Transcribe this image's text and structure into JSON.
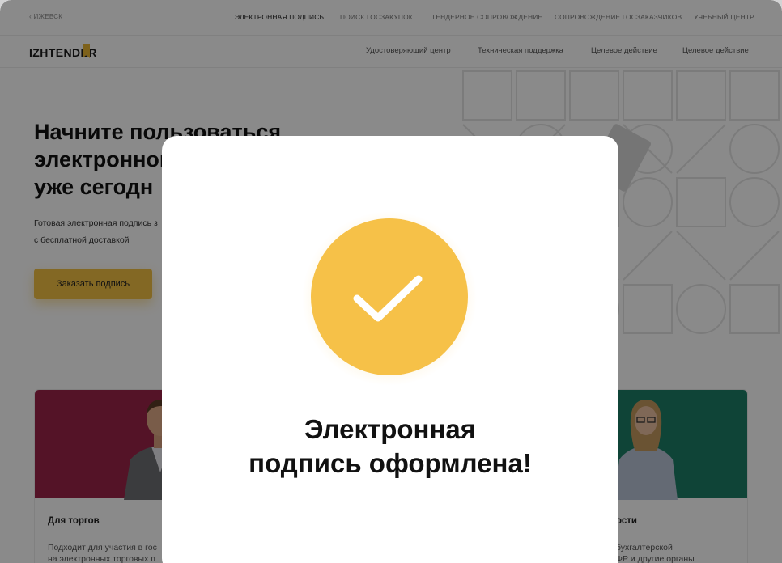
{
  "topbar": {
    "city": "‹ ИЖЕВСК",
    "nav": [
      "ЭЛЕКТРОННАЯ ПОДПИСЬ",
      "ПОИСК ГОСЗАКУПОК",
      "ТЕНДЕРНОЕ СОПРОВОЖДЕНИЕ",
      "СОПРОВОЖДЕНИЕ ГОСЗАКАЗЧИКОВ",
      "УЧЕБНЫЙ ЦЕНТР"
    ]
  },
  "navbar": {
    "logo": "IZHTENDER",
    "items": [
      "Удостоверяющий центр",
      "Техническая поддержка",
      "Целевое действие",
      "Целевое действие"
    ]
  },
  "hero": {
    "title_lines": [
      "Начните пользоваться",
      "электронной",
      "уже сегодн"
    ],
    "subtitle_lines": [
      "Готовая электронная подпись з",
      "с бесплатной доставкой"
    ],
    "order_button": "Заказать подпись"
  },
  "cards": [
    {
      "title": "Для торгов",
      "text_lines": [
        "Подходит для участия в гос",
        "на электронных торговых п"
      ]
    },
    {
      "title": "ости",
      "text_lines": [
        "бухгалтерской",
        "ФР и другие органы"
      ]
    }
  ],
  "modal": {
    "title_lines": [
      "Электронная",
      "подпись оформлена!"
    ],
    "icon": "checkmark-icon"
  },
  "colors": {
    "accent": "#f6c148",
    "card_1": "#9c2448",
    "card_2": "#1c7e66",
    "overlay": "rgba(0,0,0,0.46)"
  }
}
